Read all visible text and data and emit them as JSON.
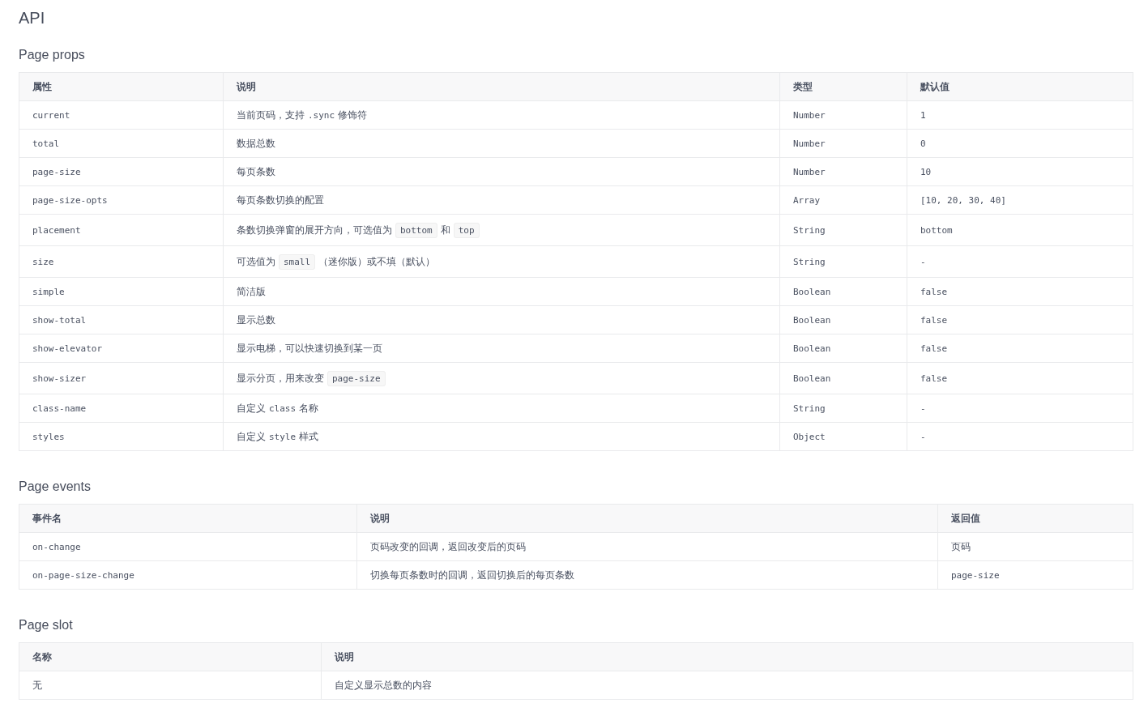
{
  "title": "API",
  "sections": [
    {
      "heading": "Page props",
      "columns": [
        "属性",
        "说明",
        "类型",
        "默认值"
      ],
      "rows": [
        [
          [
            {
              "kind": "mono",
              "text": "current"
            }
          ],
          [
            {
              "kind": "text",
              "text": "当前页码，支持"
            },
            {
              "kind": "mono",
              "text": ".sync"
            },
            {
              "kind": "text",
              "text": "修饰符"
            }
          ],
          [
            {
              "kind": "mono",
              "text": "Number"
            }
          ],
          [
            {
              "kind": "mono",
              "text": "1"
            }
          ]
        ],
        [
          [
            {
              "kind": "mono",
              "text": "total"
            }
          ],
          [
            {
              "kind": "text",
              "text": "数据总数"
            }
          ],
          [
            {
              "kind": "mono",
              "text": "Number"
            }
          ],
          [
            {
              "kind": "mono",
              "text": "0"
            }
          ]
        ],
        [
          [
            {
              "kind": "mono",
              "text": "page-size"
            }
          ],
          [
            {
              "kind": "text",
              "text": "每页条数"
            }
          ],
          [
            {
              "kind": "mono",
              "text": "Number"
            }
          ],
          [
            {
              "kind": "mono",
              "text": "10"
            }
          ]
        ],
        [
          [
            {
              "kind": "mono",
              "text": "page-size-opts"
            }
          ],
          [
            {
              "kind": "text",
              "text": "每页条数切换的配置"
            }
          ],
          [
            {
              "kind": "mono",
              "text": "Array"
            }
          ],
          [
            {
              "kind": "mono",
              "text": "[10, 20, 30, 40]"
            }
          ]
        ],
        [
          [
            {
              "kind": "mono",
              "text": "placement"
            }
          ],
          [
            {
              "kind": "text",
              "text": "条数切换弹窗的展开方向，可选值为"
            },
            {
              "kind": "code",
              "text": "bottom"
            },
            {
              "kind": "text",
              "text": "和"
            },
            {
              "kind": "code",
              "text": "top"
            }
          ],
          [
            {
              "kind": "mono",
              "text": "String"
            }
          ],
          [
            {
              "kind": "mono",
              "text": "bottom"
            }
          ]
        ],
        [
          [
            {
              "kind": "mono",
              "text": "size"
            }
          ],
          [
            {
              "kind": "text",
              "text": "可选值为"
            },
            {
              "kind": "code",
              "text": "small"
            },
            {
              "kind": "text",
              "text": "（迷你版）或不填（默认）"
            }
          ],
          [
            {
              "kind": "mono",
              "text": "String"
            }
          ],
          [
            {
              "kind": "mono",
              "text": "-"
            }
          ]
        ],
        [
          [
            {
              "kind": "mono",
              "text": "simple"
            }
          ],
          [
            {
              "kind": "text",
              "text": "简洁版"
            }
          ],
          [
            {
              "kind": "mono",
              "text": "Boolean"
            }
          ],
          [
            {
              "kind": "mono",
              "text": "false"
            }
          ]
        ],
        [
          [
            {
              "kind": "mono",
              "text": "show-total"
            }
          ],
          [
            {
              "kind": "text",
              "text": "显示总数"
            }
          ],
          [
            {
              "kind": "mono",
              "text": "Boolean"
            }
          ],
          [
            {
              "kind": "mono",
              "text": "false"
            }
          ]
        ],
        [
          [
            {
              "kind": "mono",
              "text": "show-elevator"
            }
          ],
          [
            {
              "kind": "text",
              "text": "显示电梯，可以快速切换到某一页"
            }
          ],
          [
            {
              "kind": "mono",
              "text": "Boolean"
            }
          ],
          [
            {
              "kind": "mono",
              "text": "false"
            }
          ]
        ],
        [
          [
            {
              "kind": "mono",
              "text": "show-sizer"
            }
          ],
          [
            {
              "kind": "text",
              "text": "显示分页，用来改变"
            },
            {
              "kind": "code",
              "text": "page-size"
            }
          ],
          [
            {
              "kind": "mono",
              "text": "Boolean"
            }
          ],
          [
            {
              "kind": "mono",
              "text": "false"
            }
          ]
        ],
        [
          [
            {
              "kind": "mono",
              "text": "class-name"
            }
          ],
          [
            {
              "kind": "text",
              "text": "自定义"
            },
            {
              "kind": "mono",
              "text": "class"
            },
            {
              "kind": "text",
              "text": "名称"
            }
          ],
          [
            {
              "kind": "mono",
              "text": "String"
            }
          ],
          [
            {
              "kind": "mono",
              "text": "-"
            }
          ]
        ],
        [
          [
            {
              "kind": "mono",
              "text": "styles"
            }
          ],
          [
            {
              "kind": "text",
              "text": "自定义"
            },
            {
              "kind": "mono",
              "text": "style"
            },
            {
              "kind": "text",
              "text": "样式"
            }
          ],
          [
            {
              "kind": "mono",
              "text": "Object"
            }
          ],
          [
            {
              "kind": "mono",
              "text": "-"
            }
          ]
        ]
      ]
    },
    {
      "heading": "Page events",
      "columns": [
        "事件名",
        "说明",
        "返回值"
      ],
      "rows": [
        [
          [
            {
              "kind": "mono",
              "text": "on-change"
            }
          ],
          [
            {
              "kind": "text",
              "text": "页码改变的回调，返回改变后的页码"
            }
          ],
          [
            {
              "kind": "text",
              "text": "页码"
            }
          ]
        ],
        [
          [
            {
              "kind": "mono",
              "text": "on-page-size-change"
            }
          ],
          [
            {
              "kind": "text",
              "text": "切换每页条数时的回调，返回切换后的每页条数"
            }
          ],
          [
            {
              "kind": "mono",
              "text": "page-size"
            }
          ]
        ]
      ]
    },
    {
      "heading": "Page slot",
      "columns": [
        "名称",
        "说明"
      ],
      "rows": [
        [
          [
            {
              "kind": "text",
              "text": "无"
            }
          ],
          [
            {
              "kind": "text",
              "text": "自定义显示总数的内容"
            }
          ]
        ]
      ]
    }
  ]
}
